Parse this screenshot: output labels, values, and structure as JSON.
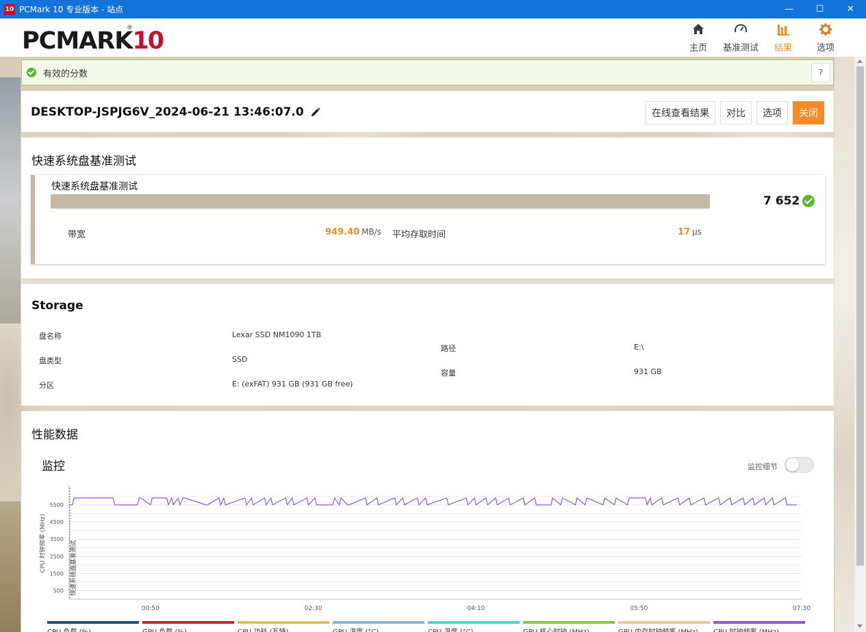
{
  "window": {
    "icon_text": "10",
    "title": "PCMark 10 专业版本 - 站点",
    "minimize": "—",
    "maximize": "☐",
    "close": "✕"
  },
  "logo": {
    "text": "PCMARK",
    "number": "10",
    "registered": "®"
  },
  "nav": [
    {
      "label": "主页",
      "icon": "home-icon",
      "active": false
    },
    {
      "label": "基准测试",
      "icon": "gauge-icon",
      "active": false
    },
    {
      "label": "结果",
      "icon": "bar-chart-icon",
      "active": true
    },
    {
      "label": "选项",
      "icon": "gear-icon",
      "active": false
    }
  ],
  "banner": {
    "text": "有效的分数",
    "help": "?"
  },
  "result": {
    "title": "DESKTOP-JSPJG6V_2024-06-21 13:46:07.0",
    "buttons": {
      "online": "在线查看结果",
      "compare": "对比",
      "options": "选项",
      "close": "关闭"
    }
  },
  "benchmark": {
    "section_title": "快速系统盘基准测试",
    "card_title": "快速系统盘基准测试",
    "score": "7 652",
    "bandwidth_label": "带宽",
    "bandwidth_value": "949.40",
    "bandwidth_unit": "MB/s",
    "access_label": "平均存取时间",
    "access_value": "17",
    "access_unit": "μs"
  },
  "storage": {
    "section_title": "Storage",
    "name_label": "盘名称",
    "name_value": "Lexar SSD NM1090 1TB",
    "type_label": "盘类型",
    "type_value": "SSD",
    "partition_label": "分区",
    "partition_value": "E: (exFAT) 931 GB (931 GB free)",
    "path_label": "路径",
    "path_value": "E:\\",
    "capacity_label": "容量",
    "capacity_value": "931 GB"
  },
  "perf": {
    "section_title": "性能数据",
    "monitor_title": "监控",
    "toggle_label": "监控细节",
    "legend": [
      {
        "label": "CPU 负载 (%)",
        "color": "#1f4e79"
      },
      {
        "label": "GPU 负载 (%)",
        "color": "#c0282f"
      },
      {
        "label": "CPU 功耗 (瓦特)",
        "color": "#d4c35a"
      },
      {
        "label": "GPU 温度 (°C)",
        "color": "#8ab4de"
      },
      {
        "label": "CPU 温度 (°C)",
        "color": "#4dd6c4"
      },
      {
        "label": "GPU 核心时钟 (MHz)",
        "color": "#8dc04a"
      },
      {
        "label": "GPU 内存时钟频率 (MHz)",
        "color": "#e6c99a"
      },
      {
        "label": "CPU 时钟频率 (MHz)",
        "color": "#8e5bc2"
      }
    ]
  },
  "chart_data": {
    "type": "line",
    "ylabel": "CPU 时钟频率 (MHz)",
    "annotation": "快速系统盘基准测试",
    "yticks": [
      500,
      1500,
      2500,
      3500,
      4500,
      5500
    ],
    "ylim": [
      0,
      6500
    ],
    "xticks": [
      "00:50",
      "02:30",
      "04:10",
      "05:50",
      "07:30"
    ],
    "xlim": [
      0,
      450
    ],
    "series": [
      {
        "name": "CPU 时钟频率 (MHz)",
        "color": "#8e5bc2",
        "x": [
          0,
          2,
          3,
          27,
          28,
          42,
          43,
          44,
          50,
          51,
          60,
          61,
          63,
          64,
          67,
          68,
          70,
          71,
          84,
          85,
          92,
          93,
          95,
          96,
          108,
          109,
          112,
          113,
          120,
          121,
          124,
          125,
          133,
          134,
          137,
          138,
          146,
          147,
          151,
          152,
          162,
          163,
          166,
          167,
          171,
          172,
          182,
          183,
          189,
          190,
          200,
          201,
          205,
          206,
          214,
          215,
          219,
          220,
          232,
          233,
          244,
          245,
          249,
          250,
          256,
          257,
          262,
          263,
          270,
          271,
          279,
          280,
          286,
          287,
          296,
          297,
          302,
          303,
          311,
          312,
          317,
          318,
          328,
          329,
          335,
          336,
          343,
          344,
          354,
          355,
          357,
          358,
          364,
          365,
          374,
          375,
          381,
          382,
          390,
          391,
          399,
          400,
          406,
          407,
          414,
          415,
          420,
          421,
          427,
          428,
          432,
          433,
          440,
          441,
          447
        ],
        "y": [
          5500,
          5500,
          5900,
          5900,
          5500,
          5500,
          5900,
          5900,
          5500,
          5900,
          5900,
          5500,
          5900,
          5500,
          5900,
          5500,
          5900,
          5900,
          5500,
          5500,
          5900,
          5500,
          5900,
          5500,
          5900,
          5500,
          5900,
          5500,
          5900,
          5500,
          5900,
          5500,
          5900,
          5500,
          5900,
          5500,
          5900,
          5500,
          5900,
          5500,
          5500,
          5900,
          5500,
          5900,
          5500,
          5500,
          5900,
          5500,
          5900,
          5500,
          5900,
          5500,
          5900,
          5500,
          5900,
          5500,
          5900,
          5500,
          5900,
          5500,
          5900,
          5500,
          5900,
          5500,
          5900,
          5500,
          5900,
          5500,
          5900,
          5500,
          5900,
          5500,
          5900,
          5500,
          5500,
          5900,
          5500,
          5900,
          5500,
          5900,
          5500,
          5900,
          5500,
          5900,
          5500,
          5900,
          5500,
          5900,
          5900,
          5500,
          5900,
          5500,
          5900,
          5500,
          5900,
          5500,
          5900,
          5500,
          5900,
          5500,
          5900,
          5500,
          5900,
          5500,
          5900,
          5500,
          5900,
          5500,
          5900,
          5500,
          5900,
          5500,
          5900,
          5500,
          5500
        ]
      }
    ]
  }
}
